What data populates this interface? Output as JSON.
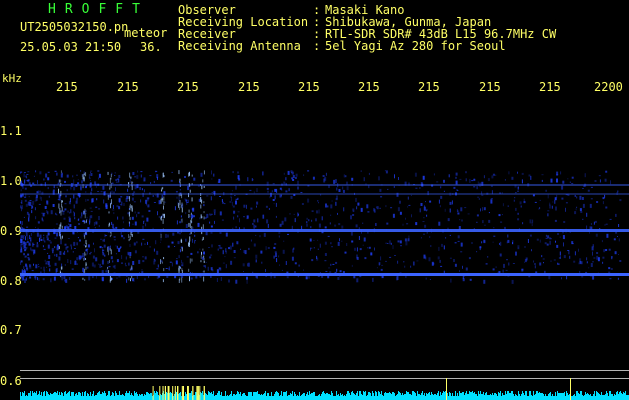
{
  "header": {
    "logo": "HROFFT",
    "filename": "UT2505032150.pn",
    "meteor_label": "meteor",
    "datetime": "25.05.03 21:50",
    "meteor_count": "36.",
    "info": [
      {
        "label": "Observer",
        "value": "Masaki Kano"
      },
      {
        "label": "Receiving Location",
        "value": "Shibukawa, Gunma, Japan"
      },
      {
        "label": "Receiver",
        "value": "RTL-SDR SDR# 43dB L15 96.7MHz CW"
      },
      {
        "label": "Receiving Antenna",
        "value": "5el Yagi Az 280 for Seoul"
      }
    ]
  },
  "axis": {
    "unit": "kHz",
    "time_ticks": [
      "215",
      "215",
      "215",
      "215",
      "215",
      "215",
      "215",
      "215",
      "215",
      "2200"
    ],
    "freq_labels": [
      "1.1",
      "1.0",
      "0.9",
      "0.8",
      "0.7",
      "0.6"
    ]
  },
  "colors": {
    "background": "#000000",
    "header_text": "#ffff66",
    "logo": "#38ff38",
    "signal": "#3c64ff",
    "meteor": "#a0c8ff",
    "scatter": "#2040ff",
    "bottom_bar": "#00e0ff",
    "spike": "#ffff66",
    "ref_line": "#b4b4b4"
  }
}
